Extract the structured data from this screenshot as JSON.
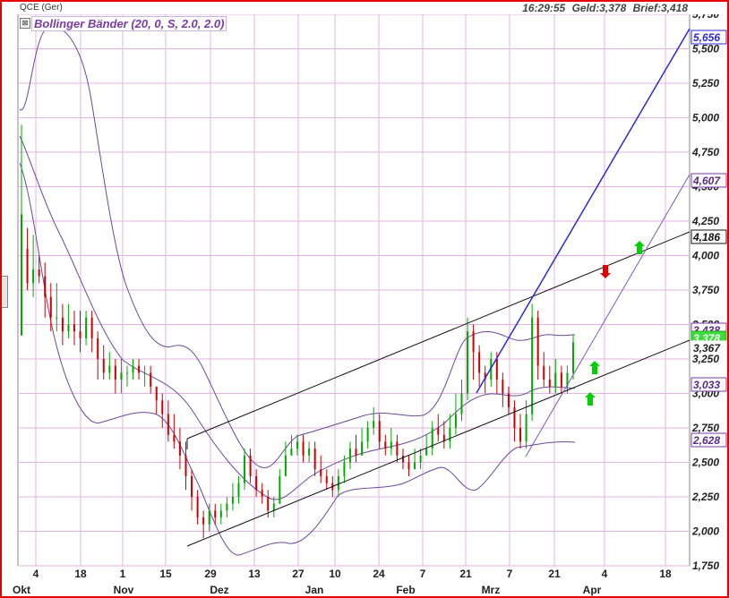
{
  "header": {
    "symbol": "QCE (Ger)",
    "time": "16:29:55",
    "geld": "Geld:3,378",
    "brief": "Brief:3,418",
    "collapse_glyph": "⊠"
  },
  "indicator": {
    "label": "Bollinger Bänder (20, 0, S, 2.0, 2.0)"
  },
  "chart_data": {
    "type": "candlestick",
    "y_ticks": [
      "5,750",
      "5,500",
      "5,250",
      "5,000",
      "4,750",
      "4,500",
      "4,250",
      "4,000",
      "3,750",
      "3,500",
      "3,250",
      "3,000",
      "2,750",
      "2,500",
      "2,250",
      "2,000",
      "1,750"
    ],
    "ylim": [
      1.75,
      5.75
    ],
    "x_day_labels": [
      "4",
      "18",
      "1",
      "15",
      "29",
      "13",
      "27",
      "10",
      "24",
      "7",
      "21",
      "7",
      "21",
      "4",
      "18"
    ],
    "x_month_labels": [
      "Okt",
      "Nov",
      "Dez",
      "Jan",
      "Feb",
      "Mrz",
      "Apr"
    ],
    "price_tags": [
      {
        "value": "5,656",
        "kind": "blue"
      },
      {
        "value": "4,607",
        "kind": "purple"
      },
      {
        "value": "4,186",
        "kind": "black"
      },
      {
        "value": "3,438",
        "kind": "purple"
      },
      {
        "value": "3,378",
        "kind": "green"
      },
      {
        "value": "3,367",
        "kind": "plain"
      },
      {
        "value": "3,033",
        "kind": "purple"
      },
      {
        "value": "2,628",
        "kind": "purple"
      }
    ],
    "colors": {
      "grid": "#e6b3e6",
      "band": "#6a4a9a",
      "up": "#00aa00",
      "down": "#cc0000",
      "trend": "#111111",
      "blue_trend": "#2a2ae0",
      "purple_trend": "#7a5ac0",
      "arrow_up": "#00d000",
      "arrow_down": "#e00000"
    },
    "candles": [
      [
        3.42,
        4.3,
        4.95,
        4.05
      ],
      [
        4.05,
        3.8,
        4.2,
        3.75
      ],
      [
        3.8,
        3.9,
        4.15,
        3.7
      ],
      [
        3.9,
        3.85,
        4.0,
        3.8
      ],
      [
        3.85,
        3.7,
        3.95,
        3.55
      ],
      [
        3.7,
        3.55,
        3.8,
        3.45
      ],
      [
        3.55,
        3.55,
        3.8,
        3.45
      ],
      [
        3.55,
        3.45,
        3.65,
        3.35
      ],
      [
        3.45,
        3.5,
        3.65,
        3.4
      ],
      [
        3.5,
        3.45,
        3.6,
        3.35
      ],
      [
        3.45,
        3.4,
        3.6,
        3.3
      ],
      [
        3.4,
        3.55,
        3.6,
        3.35
      ],
      [
        3.55,
        3.4,
        3.6,
        3.3
      ],
      [
        3.4,
        3.25,
        3.45,
        3.1
      ],
      [
        3.25,
        3.15,
        3.35,
        3.1
      ],
      [
        3.15,
        3.2,
        3.3,
        3.1
      ],
      [
        3.2,
        3.1,
        3.25,
        3.0
      ],
      [
        3.1,
        3.15,
        3.25,
        3.0
      ],
      [
        3.15,
        3.15,
        3.2,
        3.05
      ],
      [
        3.15,
        3.2,
        3.25,
        3.1
      ],
      [
        3.2,
        3.15,
        3.25,
        3.1
      ],
      [
        3.15,
        3.15,
        3.2,
        3.05
      ],
      [
        3.15,
        3.05,
        3.2,
        3.0
      ],
      [
        3.05,
        2.95,
        3.05,
        2.85
      ],
      [
        2.95,
        2.85,
        3.0,
        2.75
      ],
      [
        2.85,
        2.7,
        2.95,
        2.65
      ],
      [
        2.7,
        2.65,
        2.85,
        2.6
      ],
      [
        2.65,
        2.55,
        2.75,
        2.45
      ],
      [
        2.55,
        2.4,
        2.65,
        2.3
      ],
      [
        2.4,
        2.25,
        2.45,
        2.15
      ],
      [
        2.25,
        2.1,
        2.3,
        2.05
      ],
      [
        2.1,
        2.05,
        2.15,
        1.95
      ],
      [
        2.05,
        2.15,
        2.2,
        2.0
      ],
      [
        2.15,
        2.1,
        2.2,
        2.05
      ],
      [
        2.1,
        2.15,
        2.2,
        2.05
      ],
      [
        2.15,
        2.2,
        2.25,
        2.1
      ],
      [
        2.2,
        2.25,
        2.35,
        2.15
      ],
      [
        2.25,
        2.35,
        2.4,
        2.2
      ],
      [
        2.35,
        2.55,
        2.6,
        2.3
      ],
      [
        2.55,
        2.4,
        2.6,
        2.35
      ],
      [
        2.4,
        2.3,
        2.45,
        2.25
      ],
      [
        2.3,
        2.25,
        2.35,
        2.2
      ],
      [
        2.25,
        2.15,
        2.3,
        2.1
      ],
      [
        2.15,
        2.2,
        2.25,
        2.1
      ],
      [
        2.2,
        2.4,
        2.45,
        2.2
      ],
      [
        2.4,
        2.55,
        2.65,
        2.4
      ],
      [
        2.55,
        2.6,
        2.7,
        2.55
      ],
      [
        2.6,
        2.65,
        2.7,
        2.55
      ],
      [
        2.65,
        2.55,
        2.7,
        2.5
      ],
      [
        2.55,
        2.6,
        2.65,
        2.5
      ],
      [
        2.6,
        2.45,
        2.65,
        2.4
      ],
      [
        2.45,
        2.4,
        2.55,
        2.35
      ],
      [
        2.4,
        2.35,
        2.45,
        2.3
      ],
      [
        2.35,
        2.3,
        2.4,
        2.25
      ],
      [
        2.3,
        2.4,
        2.45,
        2.25
      ],
      [
        2.4,
        2.5,
        2.55,
        2.35
      ],
      [
        2.5,
        2.6,
        2.65,
        2.45
      ],
      [
        2.6,
        2.55,
        2.7,
        2.5
      ],
      [
        2.55,
        2.65,
        2.75,
        2.55
      ],
      [
        2.65,
        2.75,
        2.8,
        2.6
      ],
      [
        2.75,
        2.8,
        2.9,
        2.7
      ],
      [
        2.8,
        2.65,
        2.85,
        2.6
      ],
      [
        2.65,
        2.6,
        2.7,
        2.55
      ],
      [
        2.6,
        2.65,
        2.75,
        2.55
      ],
      [
        2.65,
        2.55,
        2.7,
        2.5
      ],
      [
        2.55,
        2.5,
        2.6,
        2.45
      ],
      [
        2.5,
        2.45,
        2.55,
        2.4
      ],
      [
        2.45,
        2.5,
        2.6,
        2.45
      ],
      [
        2.5,
        2.55,
        2.6,
        2.45
      ],
      [
        2.55,
        2.6,
        2.7,
        2.55
      ],
      [
        2.6,
        2.75,
        2.8,
        2.55
      ],
      [
        2.75,
        2.7,
        2.85,
        2.65
      ],
      [
        2.7,
        2.65,
        2.8,
        2.6
      ],
      [
        2.65,
        2.75,
        2.85,
        2.6
      ],
      [
        2.75,
        2.85,
        3.0,
        2.7
      ],
      [
        2.85,
        3.0,
        3.1,
        2.8
      ],
      [
        3.0,
        3.45,
        3.55,
        2.95
      ],
      [
        3.45,
        3.3,
        3.5,
        3.1
      ],
      [
        3.3,
        3.15,
        3.35,
        3.05
      ],
      [
        3.15,
        3.1,
        3.2,
        3.0
      ],
      [
        3.1,
        3.25,
        3.3,
        3.05
      ],
      [
        3.25,
        3.1,
        3.3,
        3.0
      ],
      [
        3.1,
        3.0,
        3.15,
        2.9
      ],
      [
        3.0,
        2.9,
        3.05,
        2.85
      ],
      [
        2.9,
        2.75,
        2.95,
        2.65
      ],
      [
        2.75,
        2.65,
        2.85,
        2.6
      ],
      [
        2.65,
        2.85,
        2.95,
        2.6
      ],
      [
        2.85,
        3.55,
        3.65,
        2.8
      ],
      [
        3.55,
        3.2,
        3.6,
        3.1
      ],
      [
        3.2,
        3.1,
        3.3,
        3.05
      ],
      [
        3.1,
        3.05,
        3.2,
        3.0
      ],
      [
        3.05,
        3.15,
        3.25,
        3.0
      ],
      [
        3.15,
        3.05,
        3.2,
        3.0
      ],
      [
        3.05,
        3.15,
        3.2,
        3.0
      ],
      [
        3.15,
        3.37,
        3.43,
        3.1
      ]
    ]
  }
}
